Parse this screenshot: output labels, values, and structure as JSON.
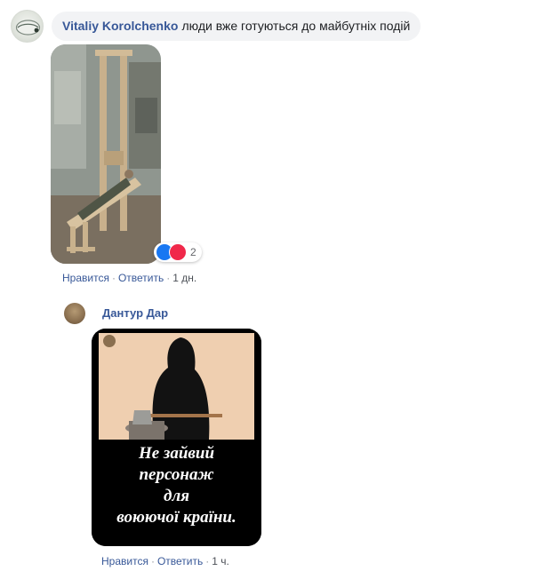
{
  "comment": {
    "author": "Vitaliy Korolchenko",
    "text": "люди вже готуються до майбутніх подій",
    "reaction_count": "2",
    "actions": {
      "like": "Нравится",
      "reply": "Ответить",
      "time": "1 дн."
    }
  },
  "reply": {
    "author": "Дантур Дар",
    "image_caption": [
      "Не зайвий",
      "персонаж",
      "для",
      "воюючої країни."
    ],
    "actions": {
      "like": "Нравится",
      "reply": "Ответить",
      "time": "1 ч."
    }
  },
  "separator": "·",
  "colors": {
    "link": "#385898",
    "bubble": "#f2f3f5",
    "like_reaction": "#1877f2",
    "love_reaction": "#f0284a"
  },
  "icons": [
    "like-reaction-icon",
    "love-reaction-icon"
  ]
}
